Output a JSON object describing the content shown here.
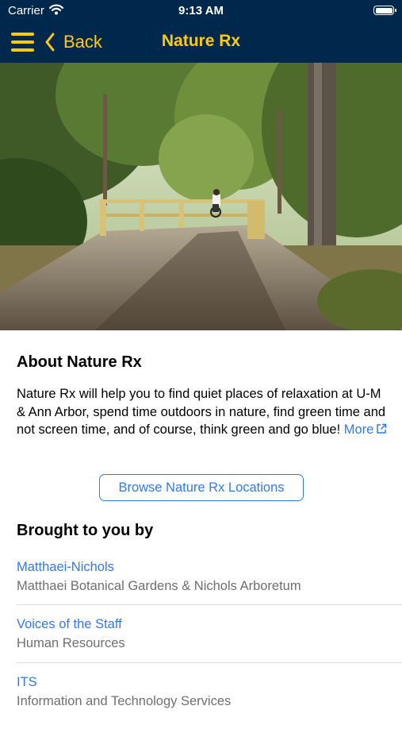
{
  "status": {
    "carrier": "Carrier",
    "time": "9:13 AM"
  },
  "nav": {
    "back_label": "Back",
    "title": "Nature Rx"
  },
  "hero": {
    "alt": "Tree-lined trail leading to a wooden bridge with a cyclist"
  },
  "about": {
    "title": "About Nature Rx",
    "body": "Nature Rx will help you to find quiet places of relaxation at U-M & Ann Arbor, spend time outdoors in nature, find green time and not screen time, and of course, think green and go blue! ",
    "more_label": "More"
  },
  "browse_button": "Browse Nature Rx Locations",
  "brought_by": {
    "title": "Brought to you by",
    "items": [
      {
        "name": "Matthaei-Nichols",
        "description": "Matthaei Botanical Gardens & Nichols Arboretum"
      },
      {
        "name": "Voices of the Staff",
        "description": "Human Resources"
      },
      {
        "name": "ITS",
        "description": "Information and Technology Services"
      }
    ]
  },
  "colors": {
    "nav_background": "#00274C",
    "accent_maize": "#FFCB05",
    "link_blue": "#2F7BEB"
  },
  "icons": [
    "wifi-icon",
    "battery-icon",
    "hamburger-menu-icon",
    "chevron-left-icon",
    "external-link-icon"
  ]
}
